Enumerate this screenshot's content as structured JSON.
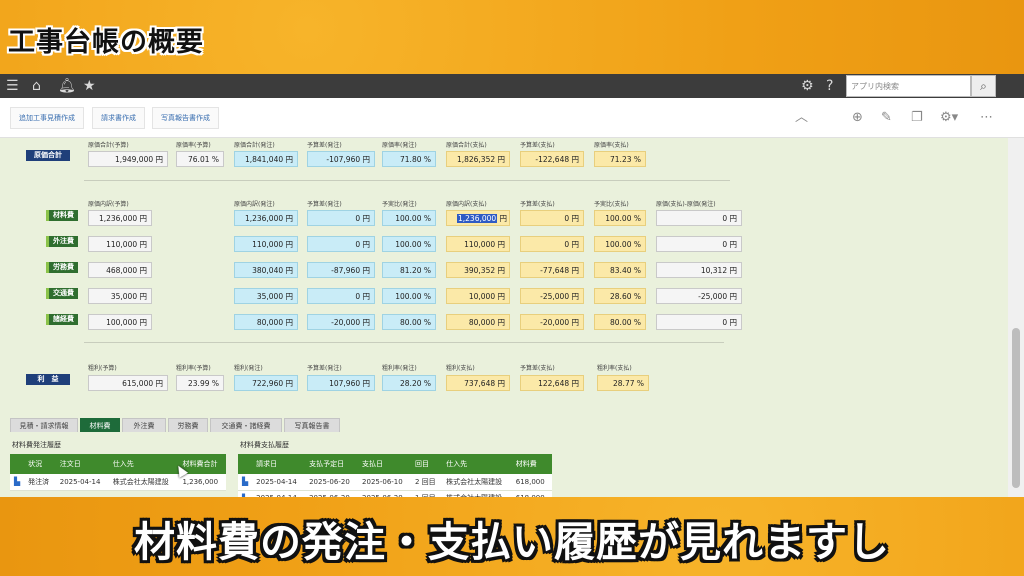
{
  "video": {
    "title": "工事台帳の概要",
    "subtitle": "材料費の発注・支払い履歴が見れますし"
  },
  "topbar": {
    "icons": [
      "menu-icon",
      "home-icon",
      "bell-icon",
      "star-icon",
      "gear-icon",
      "help-icon"
    ],
    "search_placeholder": "アプリ内検索",
    "search_icon": "search-icon"
  },
  "toolbar": {
    "buttons": [
      "追加工事見積作成",
      "請求書作成",
      "写真報告書作成"
    ],
    "icons": [
      "chevron-up-icon",
      "plus-icon",
      "edit-icon",
      "copy-icon",
      "gear-icon",
      "more-icon"
    ]
  },
  "summary": {
    "label": "原価合計",
    "fields": [
      {
        "label": "原価合計(予算)",
        "value": "1,949,000 円"
      },
      {
        "label": "原価率(予算)",
        "value": "76.01 %"
      },
      {
        "label": "原価合計(発注)",
        "value": "1,841,040 円"
      },
      {
        "label": "予算差(発注)",
        "value": "-107,960 円"
      },
      {
        "label": "原価率(発注)",
        "value": "71.80 %"
      },
      {
        "label": "原価合計(支払)",
        "value": "1,826,352 円"
      },
      {
        "label": "予算差(支払)",
        "value": "-122,648 円"
      },
      {
        "label": "原価率(支払)",
        "value": "71.23 %"
      }
    ]
  },
  "breakdown": {
    "headers": [
      "原価内訳(予算)",
      "原価内訳(発注)",
      "予算差(発注)",
      "予実比(発注)",
      "原価内訳(支払)",
      "予算差(支払)",
      "予実比(支払)",
      "原価(支払)-原価(発注)"
    ],
    "rows": [
      {
        "label": "材料費",
        "cells": [
          "1,236,000 円",
          "1,236,000 円",
          "0 円",
          "100.00 %",
          "1,236,000",
          "0 円",
          "100.00 %",
          "0 円"
        ],
        "pay_selected_suffix": " 円"
      },
      {
        "label": "外注費",
        "cells": [
          "110,000 円",
          "110,000 円",
          "0 円",
          "100.00 %",
          "110,000 円",
          "0 円",
          "100.00 %",
          "0 円"
        ]
      },
      {
        "label": "労務費",
        "cells": [
          "468,000 円",
          "380,040 円",
          "-87,960 円",
          "81.20 %",
          "390,352 円",
          "-77,648 円",
          "83.40 %",
          "10,312 円"
        ]
      },
      {
        "label": "交通費",
        "cells": [
          "35,000 円",
          "35,000 円",
          "0 円",
          "100.00 %",
          "10,000 円",
          "-25,000 円",
          "28.60 %",
          "-25,000 円"
        ]
      },
      {
        "label": "諸経費",
        "cells": [
          "100,000 円",
          "80,000 円",
          "-20,000 円",
          "80.00 %",
          "80,000 円",
          "-20,000 円",
          "80.00 %",
          "0 円"
        ]
      }
    ]
  },
  "profit": {
    "label": "利　益",
    "fields": [
      {
        "label": "粗利(予算)",
        "value": "615,000 円"
      },
      {
        "label": "粗利率(予算)",
        "value": "23.99 %"
      },
      {
        "label": "粗利(発注)",
        "value": "722,960 円"
      },
      {
        "label": "予算差(発注)",
        "value": "107,960 円"
      },
      {
        "label": "粗利率(発注)",
        "value": "28.20 %"
      },
      {
        "label": "粗利(支払)",
        "value": "737,648 円"
      },
      {
        "label": "予算差(支払)",
        "value": "122,648 円"
      },
      {
        "label": "粗利率(支払)",
        "value": "28.77 %"
      }
    ]
  },
  "tabs": {
    "items": [
      "見積・請求情報",
      "材料費",
      "外注費",
      "労務費",
      "交通費・諸経費",
      "写真報告書"
    ],
    "active": "材料費"
  },
  "order_history": {
    "title": "材料費発注履歴",
    "headers": [
      "状況",
      "注文日",
      "仕入先",
      "材料費合計"
    ],
    "rows": [
      [
        "発注済",
        "2025-04-14",
        "株式会社太陽建設",
        "1,236,000"
      ]
    ]
  },
  "payment_history": {
    "title": "材料費支払履歴",
    "headers": [
      "請求日",
      "支払予定日",
      "支払日",
      "回目",
      "仕入先",
      "材料費"
    ],
    "rows": [
      [
        "2025-04-14",
        "2025-06-20",
        "2025-06-10",
        "2 回目",
        "株式会社太陽建設",
        "618,000"
      ],
      [
        "2025-04-14",
        "2025-06-20",
        "2025-06-20",
        "1 回目",
        "株式会社太陽建設",
        "618,000"
      ]
    ]
  }
}
